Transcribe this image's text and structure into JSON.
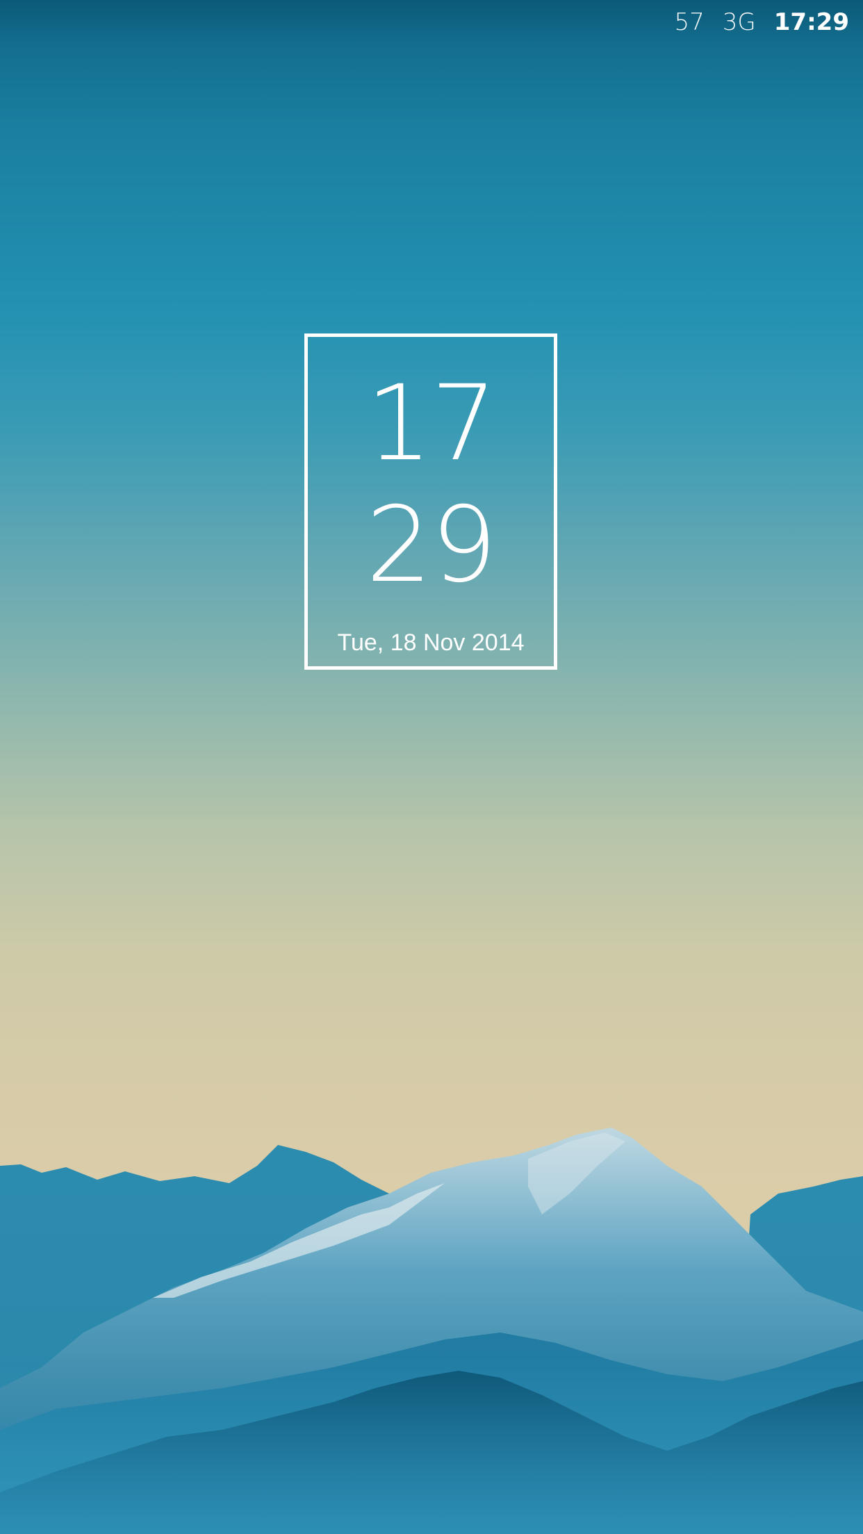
{
  "status_bar": {
    "signal_value": "57",
    "network": "3G",
    "time": "17:29"
  },
  "lock_clock": {
    "hour": "17",
    "minute": "29",
    "date": "Tue, 18 Nov 2014"
  },
  "colors": {
    "sky_top": "#0f6585",
    "sky_mid": "#8bb6ae",
    "sky_bottom": "#dccda9",
    "mountain_dark": "#0d5b7c",
    "frame": "#ffffff"
  }
}
